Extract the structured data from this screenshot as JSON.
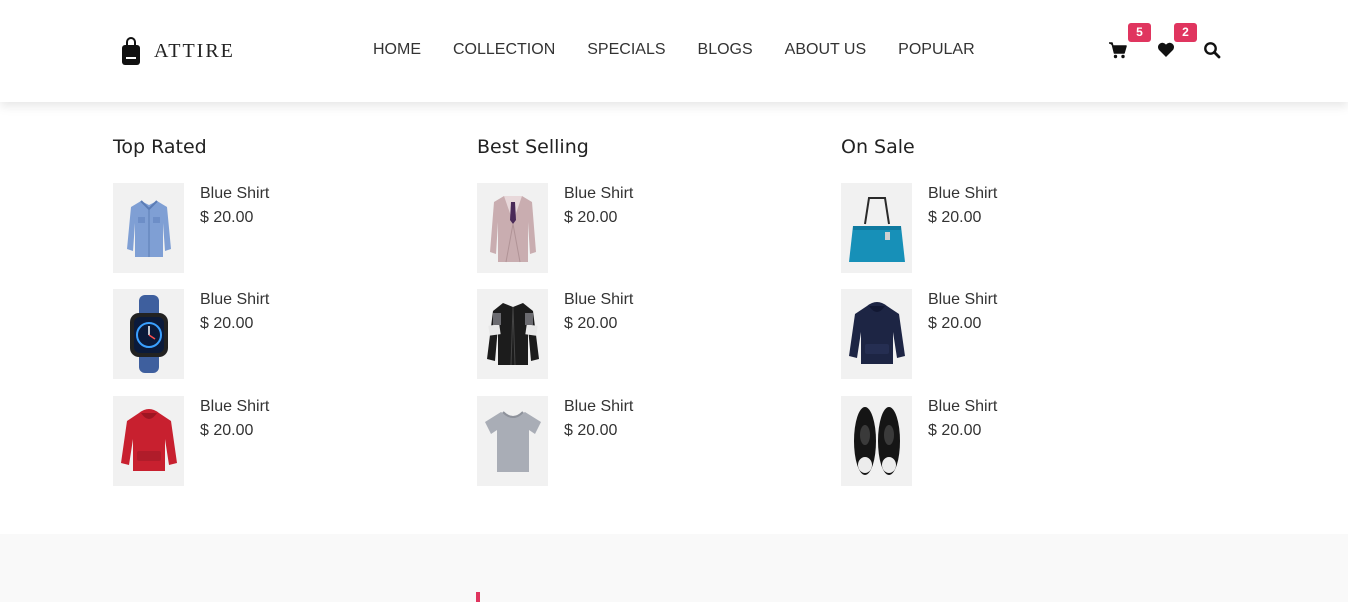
{
  "brand": {
    "name": "ATTIRE",
    "logo_icon": "shopping-bag-icon"
  },
  "nav": [
    "HOME",
    "COLLECTION",
    "SPECIALS",
    "BLOGS",
    "ABOUT US",
    "POPULAR"
  ],
  "header_icons": {
    "cart": {
      "icon": "cart-icon",
      "count": "5"
    },
    "wishlist": {
      "icon": "heart-icon",
      "count": "2"
    },
    "search": {
      "icon": "search-icon"
    }
  },
  "colors": {
    "accent": "#e0355f",
    "text": "#222222",
    "thumb_bg": "#f1f1f1",
    "footer_bg": "#f9f9f9"
  },
  "columns": [
    {
      "title": "Top Rated",
      "items": [
        {
          "name": "Blue Shirt",
          "price": "$ 20.00",
          "image": "blue-shirt"
        },
        {
          "name": "Blue Shirt",
          "price": "$ 20.00",
          "image": "smart-watch"
        },
        {
          "name": "Blue Shirt",
          "price": "$ 20.00",
          "image": "red-hoodie"
        }
      ]
    },
    {
      "title": "Best Selling",
      "items": [
        {
          "name": "Blue Shirt",
          "price": "$ 20.00",
          "image": "suit"
        },
        {
          "name": "Blue Shirt",
          "price": "$ 20.00",
          "image": "black-jacket"
        },
        {
          "name": "Blue Shirt",
          "price": "$ 20.00",
          "image": "grey-tshirt"
        }
      ]
    },
    {
      "title": "On Sale",
      "items": [
        {
          "name": "Blue Shirt",
          "price": "$ 20.00",
          "image": "teal-handbag"
        },
        {
          "name": "Blue Shirt",
          "price": "$ 20.00",
          "image": "navy-hoodie"
        },
        {
          "name": "Blue Shirt",
          "price": "$ 20.00",
          "image": "black-sneakers"
        }
      ]
    }
  ]
}
